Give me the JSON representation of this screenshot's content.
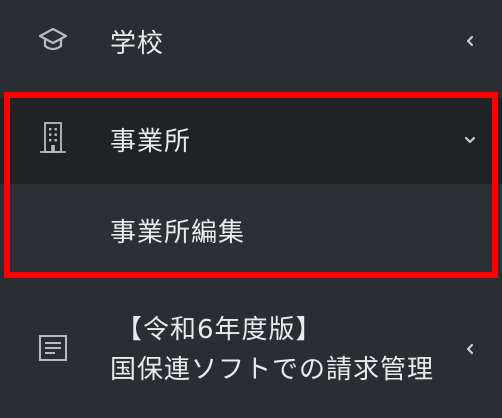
{
  "sidebar": {
    "items": [
      {
        "label": "学校",
        "icon": "graduation-cap-icon",
        "chevron": "chevron-left-icon"
      },
      {
        "label": "事業所",
        "icon": "building-icon",
        "chevron": "chevron-down-icon",
        "expanded": true,
        "children": [
          {
            "label": "事業所編集"
          }
        ]
      },
      {
        "label_line1": "【令和6年度版】",
        "label_line2": "国保連ソフトでの請求管理",
        "icon": "document-icon",
        "chevron": "chevron-left-icon"
      }
    ]
  },
  "colors": {
    "background": "#2a2e33",
    "active_item_background": "#1f2326",
    "sub_item_background": "#2c3035",
    "text": "#e9ebee",
    "icon": "#b7bcc2",
    "highlight_border": "#ff0000"
  }
}
